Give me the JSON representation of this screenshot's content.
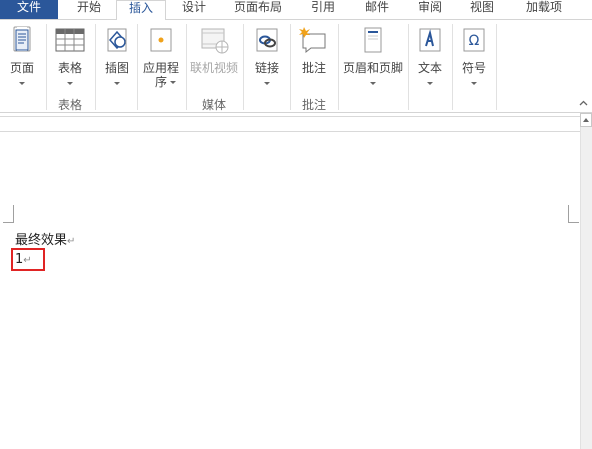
{
  "tabs": [
    {
      "label": "文件"
    },
    {
      "label": "开始"
    },
    {
      "label": "插入"
    },
    {
      "label": "设计"
    },
    {
      "label": "页面布局"
    },
    {
      "label": "引用"
    },
    {
      "label": "邮件"
    },
    {
      "label": "审阅"
    },
    {
      "label": "视图"
    },
    {
      "label": "加载项"
    }
  ],
  "ribbon": {
    "buttons": {
      "page": "页面",
      "table": "表格",
      "illustrations": "插图",
      "apps_line1": "应用程",
      "apps_line2": "序",
      "online_video": "联机视频",
      "links": "链接",
      "comment": "批注",
      "header_footer": "页眉和页脚",
      "text": "文本",
      "symbols": "符号"
    },
    "groups": {
      "tables": "表格",
      "media": "媒体",
      "comments": "批注"
    }
  },
  "document": {
    "line1": "最终效果",
    "line2": "1",
    "para_mark": "↵"
  },
  "colors": {
    "file_tab": "#2b579a",
    "active_tab_text": "#2b579a",
    "highlight_box": "#e02424"
  }
}
